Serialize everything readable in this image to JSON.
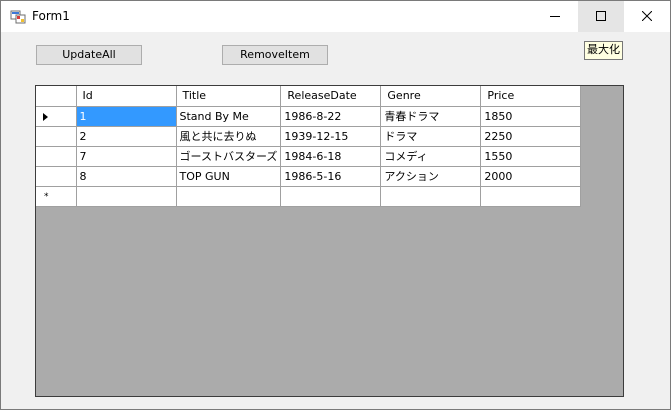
{
  "window": {
    "title": "Form1"
  },
  "toolbar": {
    "update_label": "UpdateAll",
    "remove_label": "RemoveItem"
  },
  "tooltip": {
    "text": "最大化"
  },
  "grid": {
    "columns": [
      "Id",
      "Title",
      "ReleaseDate",
      "Genre",
      "Price"
    ],
    "rows": [
      [
        "1",
        "Stand By Me",
        "1986-8-22",
        "青春ドラマ",
        "1850"
      ],
      [
        "2",
        "風と共に去りぬ",
        "1939-12-15",
        "ドラマ",
        "2250"
      ],
      [
        "7",
        "ゴーストバスターズ",
        "1984-6-18",
        "コメディ",
        "1550"
      ],
      [
        "8",
        "TOP GUN",
        "1986-5-16",
        "アクション",
        "2000"
      ]
    ],
    "new_row_marker": "*"
  },
  "colors": {
    "selection": "#3399ff",
    "grid_background": "#ababab"
  },
  "icons": [
    "app-icon",
    "minimize-icon",
    "maximize-icon",
    "close-icon",
    "current-row-arrow-icon",
    "new-row-star-icon"
  ]
}
